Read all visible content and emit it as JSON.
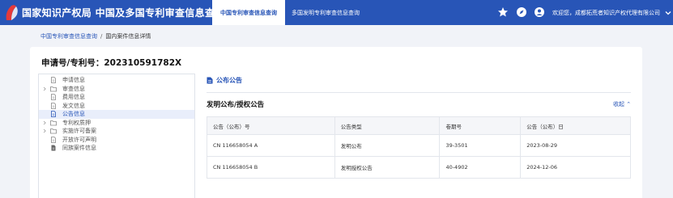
{
  "header": {
    "site_title": "国家知识产权局   中国及多国专利审查信息查询",
    "tabs": [
      {
        "label": "中国专利审查信息查询"
      },
      {
        "label": "多国发明专利审查信息查询"
      }
    ],
    "welcome": "欢迎您，成都拓荒者知识产权代理有限公司",
    "brand_color": "#2855b7"
  },
  "breadcrumb": {
    "link": "中国专利审查信息查询",
    "separator": "/",
    "current": "国内案件信息详情"
  },
  "case": {
    "application_number": "申请号/专利号：202310591782X"
  },
  "tree": {
    "items": [
      {
        "label": "申请信息",
        "icon": "document-icon",
        "expandable": false
      },
      {
        "label": "审查信息",
        "icon": "folder-icon",
        "expandable": true
      },
      {
        "label": "费用信息",
        "icon": "document-icon",
        "expandable": false
      },
      {
        "label": "发文信息",
        "icon": "document-icon",
        "expandable": false
      },
      {
        "label": "公告信息",
        "icon": "document-icon",
        "expandable": false,
        "active": true
      },
      {
        "label": "专利权质押",
        "icon": "folder-icon",
        "expandable": true
      },
      {
        "label": "实施许可备案",
        "icon": "folder-icon",
        "expandable": true
      },
      {
        "label": "开放许可声明",
        "icon": "document-icon",
        "expandable": false
      },
      {
        "label": "同族案件信息",
        "icon": "document-filled-icon",
        "expandable": false
      }
    ]
  },
  "panel": {
    "section_title": "公布公告",
    "sub_title": "发明公布/授权公告",
    "collapse_label": "收起 ⌃",
    "table": {
      "headers": [
        "公告（公布）号",
        "公告类型",
        "卷期号",
        "公告（公布）日"
      ],
      "rows": [
        [
          "CN 116658054 A",
          "发明公布",
          "39-3501",
          "2023-08-29"
        ],
        [
          "CN 116658054 B",
          "发明授权公告",
          "40-4902",
          "2024-12-06"
        ]
      ]
    }
  }
}
